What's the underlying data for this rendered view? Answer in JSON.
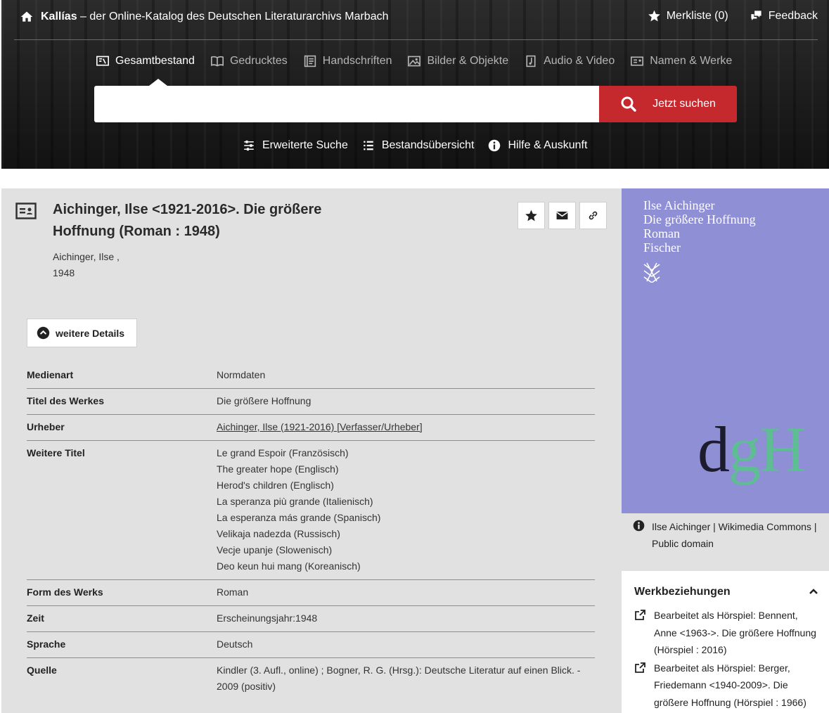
{
  "header": {
    "brand_name": "Kallías",
    "brand_tagline": "– der Online-Katalog des Deutschen Literaturarchivs Marbach",
    "merkliste_label": "Merkliste (0)",
    "feedback_label": "Feedback"
  },
  "tabs": [
    {
      "label": "Gesamtbestand",
      "icon": "books-icon",
      "active": true
    },
    {
      "label": "Gedrucktes",
      "icon": "book-icon",
      "active": false
    },
    {
      "label": "Handschriften",
      "icon": "manuscript-icon",
      "active": false
    },
    {
      "label": "Bilder & Objekte",
      "icon": "image-icon",
      "active": false
    },
    {
      "label": "Audio & Video",
      "icon": "music-icon",
      "active": false
    },
    {
      "label": "Namen & Werke",
      "icon": "id-card-icon",
      "active": false
    }
  ],
  "search": {
    "value": "",
    "button_label": "Jetzt suchen"
  },
  "sublinks": {
    "advanced": "Erweiterte Suche",
    "overview": "Bestandsübersicht",
    "help": "Hilfe & Auskunft"
  },
  "record": {
    "title": "Aichinger, Ilse <1921-2016>. Die größere Hoffnung (Roman : 1948)",
    "author": "Aichinger, Ilse ,",
    "year": "1948",
    "details_button": "weitere Details"
  },
  "properties": [
    {
      "label": "Medienart",
      "values": [
        "Normdaten"
      ]
    },
    {
      "label": "Titel des Werkes",
      "values": [
        "Die größere Hoffnung"
      ]
    },
    {
      "label": "Urheber",
      "values": [
        "Aichinger, Ilse (1921-2016) [Verfasser/Urheber]"
      ],
      "link": true
    },
    {
      "label": "Weitere Titel",
      "values": [
        "Le grand Espoir (Französisch)",
        "The greater hope (Englisch)",
        "Herod's children (Englisch)",
        "La speranza più grande (Italienisch)",
        "La esperanza más grande (Spanisch)",
        "Velikaja nadezda (Russisch)",
        "Vecje upanje (Slowenisch)",
        "Deo keun hui mang (Koreanisch)"
      ]
    },
    {
      "label": "Form des Werks",
      "values": [
        "Roman"
      ]
    },
    {
      "label": "Zeit",
      "values": [
        "Erscheinungsjahr:1948"
      ]
    },
    {
      "label": "Sprache",
      "values": [
        "Deutsch"
      ]
    },
    {
      "label": "Quelle",
      "values": [
        "Kindler (3. Aufl., online) ; Bogner, R. G. (Hrsg.): Deutsche Literatur auf einen Blick. - 2009 (positiv)"
      ]
    }
  ],
  "cover": {
    "lines": [
      "Ilse Aichinger",
      "Die größere Hoffnung",
      "Roman",
      "Fischer"
    ],
    "letters": {
      "d": "d",
      "g": "g",
      "h": "H"
    },
    "bg_color": "#8f8fd6",
    "letter_accent_color": "#5fbd93"
  },
  "credit": "Ilse Aichinger | Wikimedia Commons | Public domain",
  "werkbeziehungen": {
    "title": "Werkbeziehungen",
    "items": [
      "Bearbeitet als Hörspiel: Bennent, Anne <1963->. Die größere Hoffnung (Hörspiel : 2016)",
      "Bearbeitet als Hörspiel: Berger, Friedemann <1940-2009>. Die größere Hoffnung (Hörspiel : 1966)"
    ]
  },
  "colors": {
    "accent_red": "#c5292e",
    "panel_gray": "#e1e1e1"
  }
}
